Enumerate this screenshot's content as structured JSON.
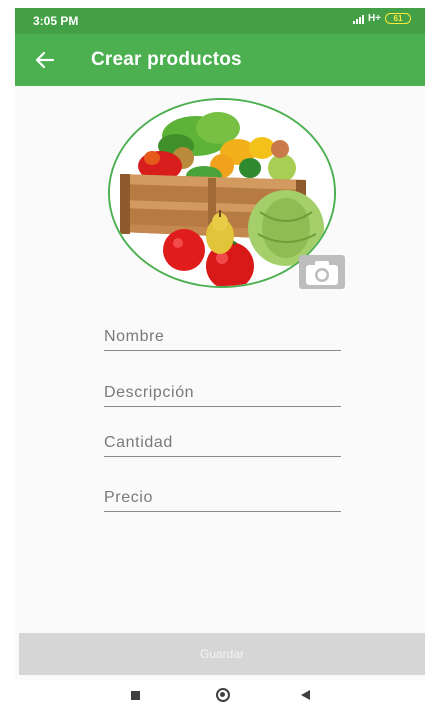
{
  "status_bar": {
    "time": "3:05 PM",
    "network": "H+",
    "battery": "61"
  },
  "app_bar": {
    "title": "Crear productos"
  },
  "form": {
    "name_label": "Nombre",
    "description_label": "Descripción",
    "quantity_label": "Cantidad",
    "price_label": "Precio"
  },
  "actions": {
    "save_label": "Guardar"
  },
  "icons": {
    "back": "arrow-left-icon",
    "camera": "camera-icon",
    "image": "vegetables-crate-image"
  },
  "colors": {
    "app_bar": "#4caf50",
    "status_bar": "#43a047",
    "button_disabled": "#d6d6d6"
  }
}
